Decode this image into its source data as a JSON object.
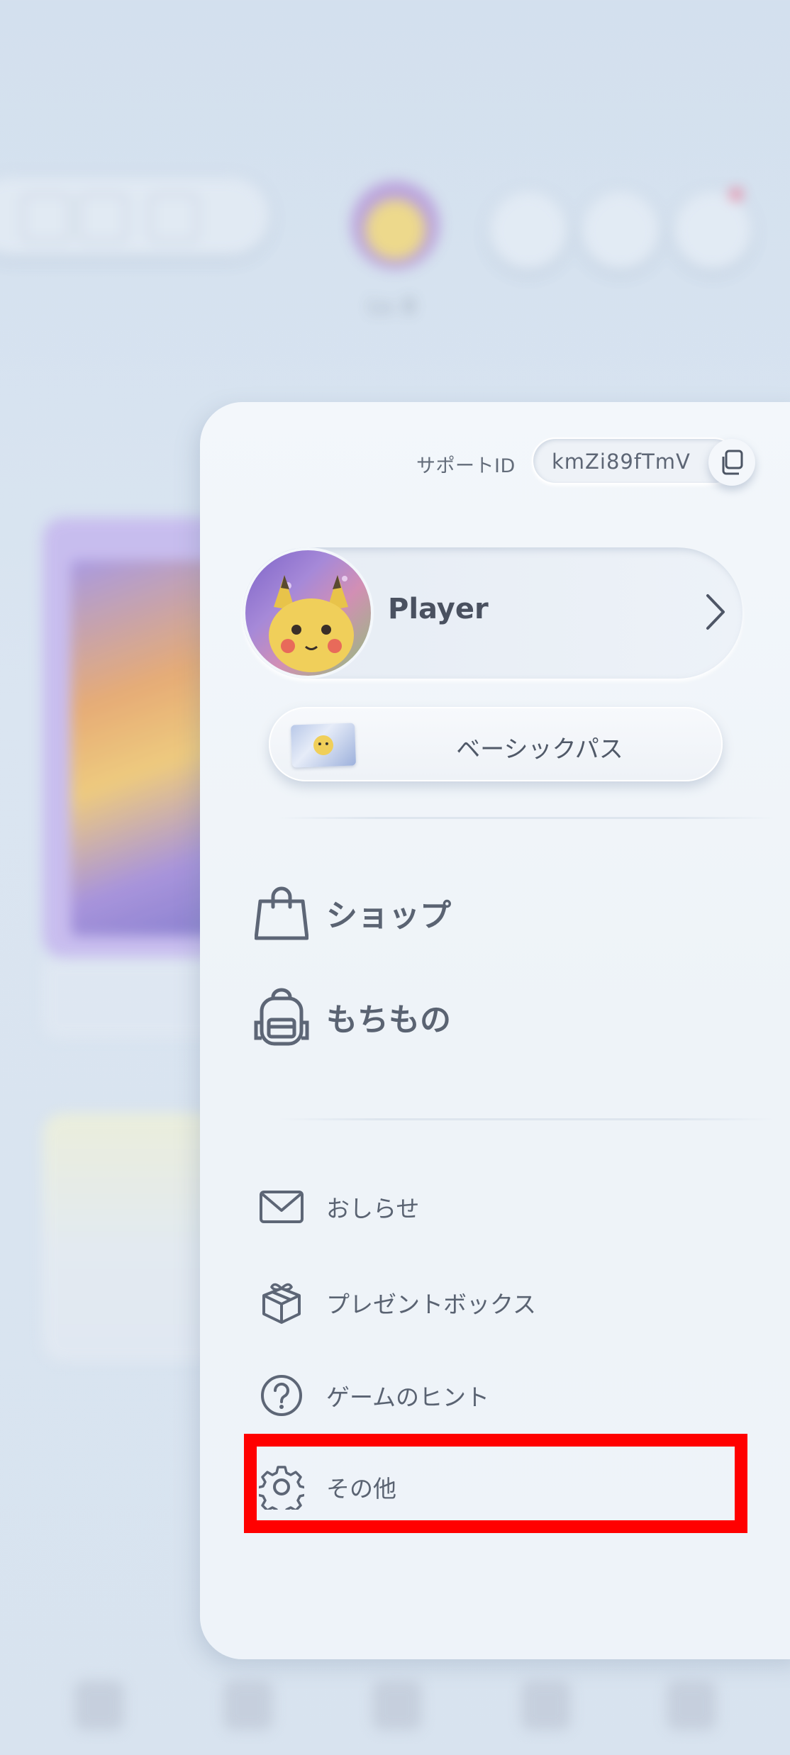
{
  "background": {
    "level_text": "Lv. 8"
  },
  "support": {
    "label": "サポートID",
    "value": "kmZi89fTmV"
  },
  "profile": {
    "name": "Player"
  },
  "pass": {
    "label": "ベーシックパス"
  },
  "main_menu": [
    {
      "label": "ショップ",
      "icon": "shopping-bag-icon"
    },
    {
      "label": "もちもの",
      "icon": "backpack-icon"
    }
  ],
  "sub_menu": [
    {
      "label": "おしらせ",
      "icon": "mail-icon"
    },
    {
      "label": "プレゼントボックス",
      "icon": "gift-box-icon"
    },
    {
      "label": "ゲームのヒント",
      "icon": "help-circle-icon"
    },
    {
      "label": "その他",
      "icon": "gear-icon"
    }
  ],
  "colors": {
    "highlight": "#ff0000",
    "icon_stroke": "#5d6676",
    "notification_dot": "#ef5a7c"
  }
}
